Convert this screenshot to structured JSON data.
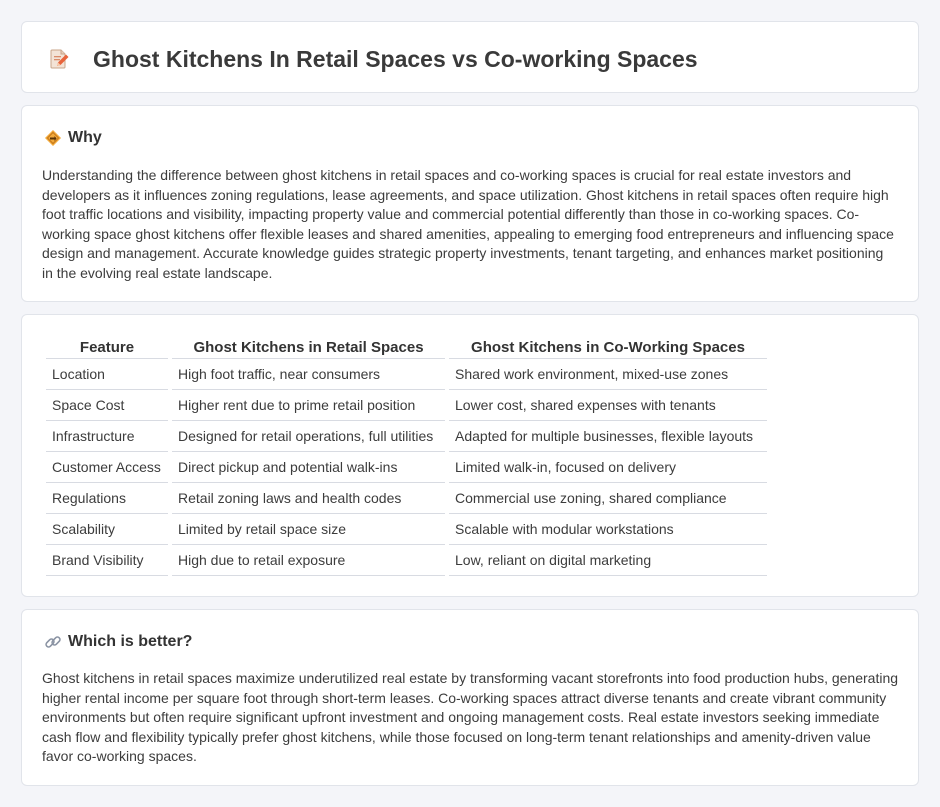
{
  "title": "Ghost Kitchens In Retail Spaces vs Co-working Spaces",
  "why": {
    "heading": "Why",
    "text": "Understanding the difference between ghost kitchens in retail spaces and co-working spaces is crucial for real estate investors and developers as it influences zoning regulations, lease agreements, and space utilization. Ghost kitchens in retail spaces often require high foot traffic locations and visibility, impacting property value and commercial potential differently than those in co-working spaces. Co-working space ghost kitchens offer flexible leases and shared amenities, appealing to emerging food entrepreneurs and influencing space design and management. Accurate knowledge guides strategic property investments, tenant targeting, and enhances market positioning in the evolving real estate landscape."
  },
  "table": {
    "headers": [
      "Feature",
      "Ghost Kitchens in Retail Spaces",
      "Ghost Kitchens in Co-Working Spaces"
    ],
    "rows": [
      [
        "Location",
        "High foot traffic, near consumers",
        "Shared work environment, mixed-use zones"
      ],
      [
        "Space Cost",
        "Higher rent due to prime retail position",
        "Lower cost, shared expenses with tenants"
      ],
      [
        "Infrastructure",
        "Designed for retail operations, full utilities",
        "Adapted for multiple businesses, flexible layouts"
      ],
      [
        "Customer Access",
        "Direct pickup and potential walk-ins",
        "Limited walk-in, focused on delivery"
      ],
      [
        "Regulations",
        "Retail zoning laws and health codes",
        "Commercial use zoning, shared compliance"
      ],
      [
        "Scalability",
        "Limited by retail space size",
        "Scalable with modular workstations"
      ],
      [
        "Brand Visibility",
        "High due to retail exposure",
        "Low, reliant on digital marketing"
      ]
    ]
  },
  "better": {
    "heading": "Which is better?",
    "text": "Ghost kitchens in retail spaces maximize underutilized real estate by transforming vacant storefronts into food production hubs, generating higher rental income per square foot through short-term leases. Co-working spaces attract diverse tenants and create vibrant community environments but often require significant upfront investment and ongoing management costs. Real estate investors seeking immediate cash flow and flexibility typically prefer ghost kitchens, while those focused on long-term tenant relationships and amenity-driven value favor co-working spaces."
  },
  "icons": {
    "title": "document-pencil-icon",
    "why": "diamond-sign-icon",
    "better": "link-icon"
  }
}
